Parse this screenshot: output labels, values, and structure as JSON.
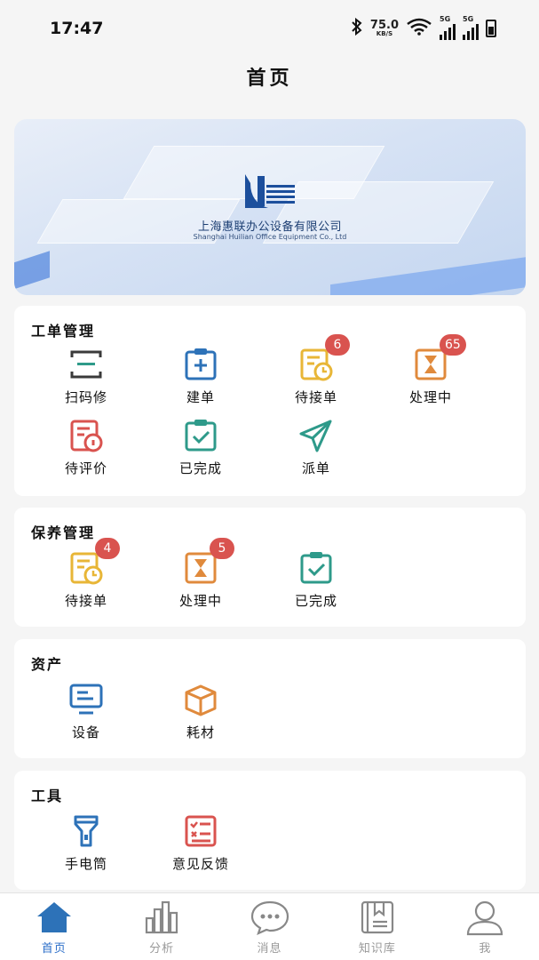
{
  "status_bar": {
    "time": "17:47",
    "net_speed_value": "75.0",
    "net_speed_unit": "KB/S",
    "signal1_tag": "5G",
    "signal2_tag": "5G"
  },
  "header": {
    "title": "首页"
  },
  "banner": {
    "company_cn": "上海惠联办公设备有限公司",
    "company_en": "Shanghai Huilian Office Equipment Co., Ltd"
  },
  "sections": {
    "work_order": {
      "title": "工单管理",
      "items": [
        {
          "label": "扫码修",
          "icon": "scan-icon"
        },
        {
          "label": "建单",
          "icon": "clipboard-add-icon"
        },
        {
          "label": "待接单",
          "icon": "pending-clock-icon",
          "badge": "6"
        },
        {
          "label": "处理中",
          "icon": "hourglass-icon",
          "badge": "65"
        },
        {
          "label": "待评价",
          "icon": "review-icon"
        },
        {
          "label": "已完成",
          "icon": "clipboard-check-icon"
        },
        {
          "label": "派单",
          "icon": "send-icon"
        }
      ]
    },
    "maintenance": {
      "title": "保养管理",
      "items": [
        {
          "label": "待接单",
          "icon": "pending-clock-icon",
          "badge": "4"
        },
        {
          "label": "处理中",
          "icon": "hourglass-icon",
          "badge": "5"
        },
        {
          "label": "已完成",
          "icon": "clipboard-check-icon"
        }
      ]
    },
    "assets": {
      "title": "资产",
      "items": [
        {
          "label": "设备",
          "icon": "monitor-icon"
        },
        {
          "label": "耗材",
          "icon": "box-icon"
        }
      ]
    },
    "tools": {
      "title": "工具",
      "items": [
        {
          "label": "手电筒",
          "icon": "flashlight-icon"
        },
        {
          "label": "意见反馈",
          "icon": "feedback-icon"
        }
      ]
    }
  },
  "tabbar": {
    "tabs": [
      {
        "label": "首页",
        "icon": "home-icon",
        "active": true
      },
      {
        "label": "分析",
        "icon": "bar-chart-icon"
      },
      {
        "label": "消息",
        "icon": "message-icon"
      },
      {
        "label": "知识库",
        "icon": "book-icon"
      },
      {
        "label": "我",
        "icon": "user-icon"
      }
    ]
  },
  "colors": {
    "accent_blue": "#2d6fc9",
    "scan_dark": "#3a3a3a",
    "green": "#2e9a8a",
    "yellow": "#e8b637",
    "orange": "#e08a3c",
    "red": "#d9534f",
    "icon_blue": "#2d72b8",
    "badge": "#d9534f"
  }
}
